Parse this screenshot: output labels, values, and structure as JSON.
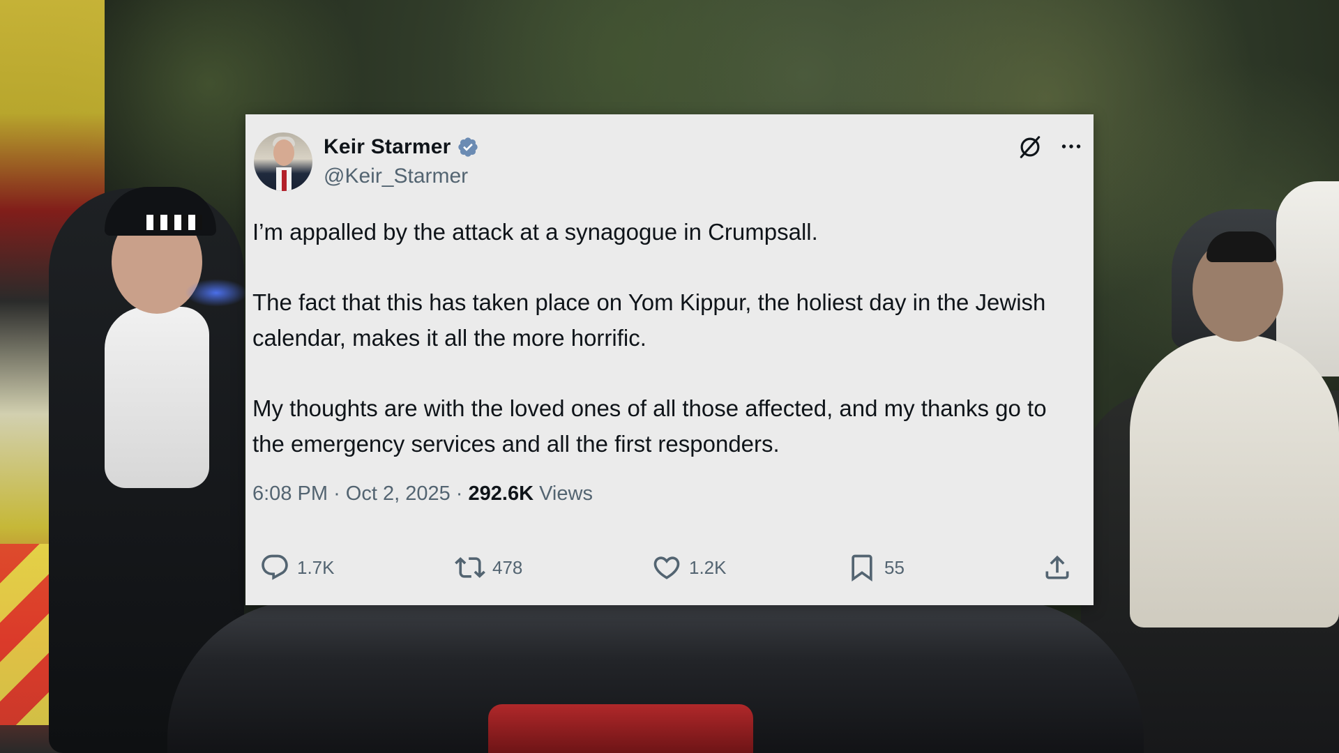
{
  "tweet": {
    "display_name": "Keir Starmer",
    "handle": "@Keir_Starmer",
    "paragraphs": [
      "I’m appalled by the attack at a synagogue in Crumpsall.",
      "The fact that this has taken place on Yom Kippur, the holiest day in the Jewish calendar, makes it all the more horrific.",
      "My thoughts are with the loved ones of all those affected, and my thanks go to the emergency services and all the first responders."
    ],
    "time": "6:08 PM",
    "date": "Oct 2, 2025",
    "separator": "·",
    "views_count": "292.6K",
    "views_label": "Views",
    "actions": {
      "replies": "1.7K",
      "retweets": "478",
      "likes": "1.2K",
      "bookmarks": "55"
    }
  },
  "icons": {
    "verified": "verified-badge-icon",
    "grok": "grok-icon",
    "more": "more-options-icon",
    "reply": "reply-icon",
    "retweet": "retweet-icon",
    "like": "heart-icon",
    "bookmark": "bookmark-icon",
    "share": "share-icon"
  },
  "colors": {
    "card_background": "#ebebeb",
    "text_primary": "#0f1419",
    "text_secondary": "#536471",
    "verified_badge": "#6b8bb3"
  }
}
